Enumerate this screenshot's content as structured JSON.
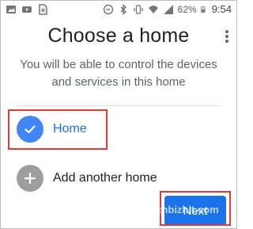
{
  "statusbar": {
    "battery": "62%",
    "time": "9:54"
  },
  "header": {
    "title": "Choose a home"
  },
  "description": {
    "line1": "You will be able to control the devices",
    "line2": "and services in this home"
  },
  "homes": [
    {
      "label": "Home",
      "icon": "check-icon",
      "selected": true
    }
  ],
  "add_home": {
    "label": "Add another home",
    "icon": "plus-icon"
  },
  "actions": {
    "next_label": "Next"
  },
  "watermark": "Techbizhit.com",
  "colors": {
    "accent": "#1a73e8",
    "selected_circle": "#4285f4",
    "add_circle": "#9e9e9e",
    "highlight": "#e53935"
  }
}
